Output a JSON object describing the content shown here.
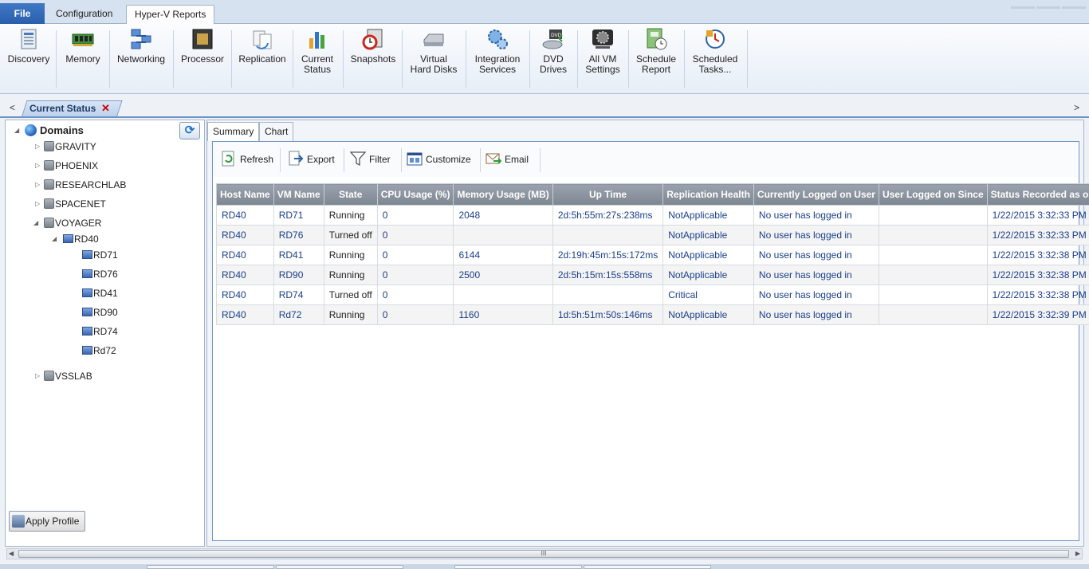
{
  "ribbon_tabs": {
    "file": "File",
    "configuration": "Configuration",
    "active": "Hyper-V Reports"
  },
  "ribbon_buttons": [
    {
      "label": "Discovery",
      "icon": "discovery-icon"
    },
    {
      "label": "Memory",
      "icon": "memory-icon"
    },
    {
      "label": "Networking",
      "icon": "networking-icon"
    },
    {
      "label": "Processor",
      "icon": "processor-icon"
    },
    {
      "label": "Replication",
      "icon": "replication-icon"
    },
    {
      "label": "Current\nStatus",
      "icon": "current-status-icon"
    },
    {
      "label": "Snapshots",
      "icon": "snapshots-icon"
    },
    {
      "label": "Virtual\nHard Disks",
      "icon": "virtual-hard-disks-icon"
    },
    {
      "label": "Integration\nServices",
      "icon": "integration-services-icon"
    },
    {
      "label": "DVD\nDrives",
      "icon": "dvd-drives-icon"
    },
    {
      "label": "All VM\nSettings",
      "icon": "all-vm-settings-icon"
    },
    {
      "label": "Schedule\nReport",
      "icon": "schedule-report-icon"
    },
    {
      "label": "Scheduled\nTasks...",
      "icon": "scheduled-tasks-icon"
    }
  ],
  "doc_tab": {
    "label": "Current Status",
    "close": "✕",
    "nav_left": "<",
    "nav_right": ">"
  },
  "tree": {
    "root": "Domains",
    "domains": [
      "GRAVITY",
      "PHOENIX",
      "RESEARCHLAB",
      "SPACENET",
      "VOYAGER"
    ],
    "host": "RD40",
    "vms": [
      "RD71",
      "RD76",
      "RD41",
      "RD90",
      "RD74",
      "Rd72"
    ],
    "last_domain": "VSSLAB"
  },
  "apply_profile": "Apply Profile",
  "subtabs": {
    "summary": "Summary",
    "chart": "Chart"
  },
  "toolbar": {
    "refresh": "Refresh",
    "export": "Export",
    "filter": "Filter",
    "customize": "Customize",
    "email": "Email"
  },
  "table": {
    "headers": [
      "Host Name",
      "VM Name",
      "State",
      "CPU Usage (%)",
      "Memory Usage (MB)",
      "Up Time",
      "Replication Health",
      "Currently Logged on User",
      "User Logged on Since",
      "Status Recorded as on"
    ],
    "rows": [
      [
        "RD40",
        "RD71",
        "Running",
        "0",
        "2048",
        "2d:5h:55m:27s:238ms",
        "NotApplicable",
        "No user has logged in",
        "",
        "1/22/2015 3:32:33 PM"
      ],
      [
        "RD40",
        "RD76",
        "Turned off",
        "0",
        "",
        "",
        "NotApplicable",
        "No user has logged in",
        "",
        "1/22/2015 3:32:33 PM"
      ],
      [
        "RD40",
        "RD41",
        "Running",
        "0",
        "6144",
        "2d:19h:45m:15s:172ms",
        "NotApplicable",
        "No user has logged in",
        "",
        "1/22/2015 3:32:38 PM"
      ],
      [
        "RD40",
        "RD90",
        "Running",
        "0",
        "2500",
        "2d:5h:15m:15s:558ms",
        "NotApplicable",
        "No user has logged in",
        "",
        "1/22/2015 3:32:38 PM"
      ],
      [
        "RD40",
        "RD74",
        "Turned off",
        "0",
        "",
        "",
        "Critical",
        "No user has logged in",
        "",
        "1/22/2015 3:32:38 PM"
      ],
      [
        "RD40",
        "Rd72",
        "Running",
        "0",
        "1160",
        "1d:5h:51m:50s:146ms",
        "NotApplicable",
        "No user has logged in",
        "",
        "1/22/2015 3:32:39 PM"
      ]
    ]
  },
  "scroll_grip": "III"
}
